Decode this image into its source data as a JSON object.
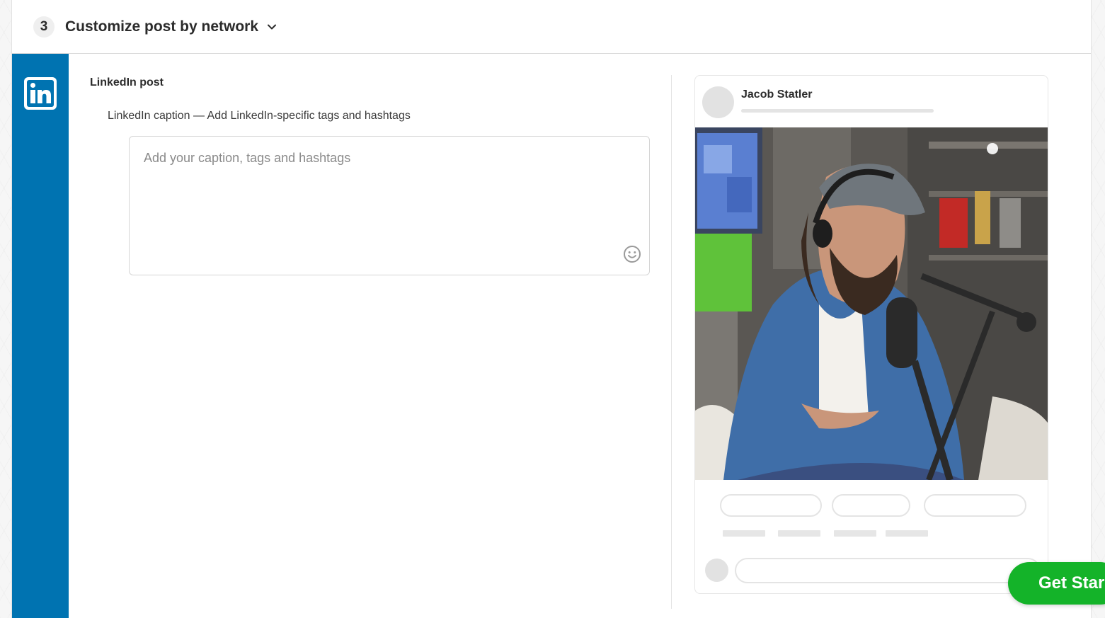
{
  "step": {
    "number": "3",
    "title": "Customize post by network",
    "chevron_icon": "chevron-down-icon"
  },
  "network": {
    "name": "LinkedIn",
    "icon": "linkedin-icon",
    "color": "#0073b1"
  },
  "editor": {
    "section_title": "LinkedIn post",
    "caption_label": "LinkedIn caption — Add LinkedIn-specific tags and hashtags",
    "caption_value": "",
    "caption_placeholder": "Add your caption, tags and hashtags",
    "emoji_icon": "emoji-smiley-icon"
  },
  "preview": {
    "author_name": "Jacob Statler",
    "image_description_icon": "post-photo"
  },
  "cta": {
    "label": "Get Star",
    "color": "#14b329"
  }
}
